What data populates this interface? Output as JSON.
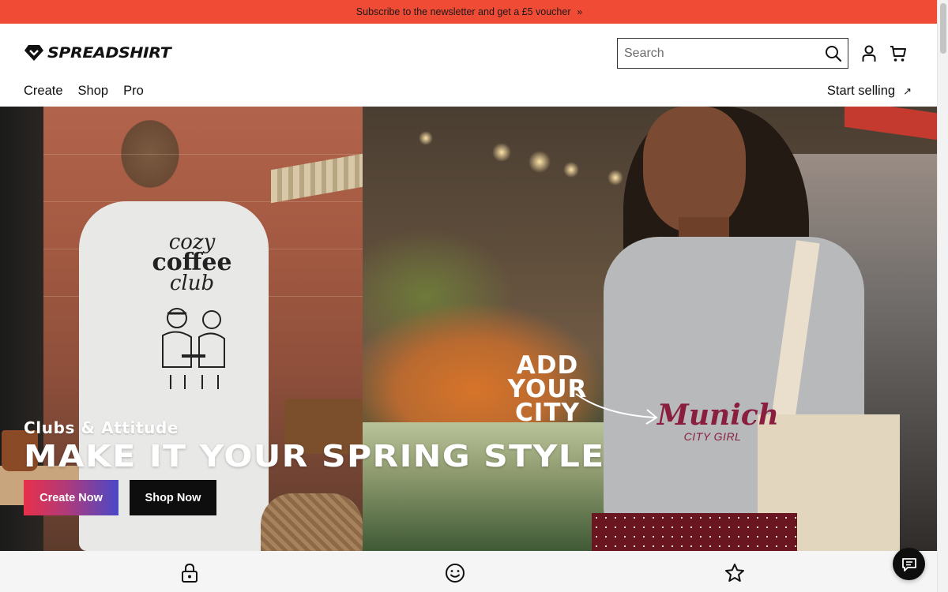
{
  "promo": {
    "text": "Subscribe to the newsletter and get a £5 voucher",
    "chevron": "»"
  },
  "header": {
    "logo_text": "SPREADSHIRT",
    "search": {
      "placeholder": "Search",
      "value": ""
    },
    "icons": [
      "search-icon",
      "account-icon",
      "cart-icon"
    ]
  },
  "nav": {
    "items": [
      {
        "label": "Create"
      },
      {
        "label": "Shop"
      },
      {
        "label": "Pro"
      }
    ],
    "start_selling": {
      "label": "Start selling",
      "arrow": "↗"
    }
  },
  "hero": {
    "eyebrow": "Clubs & Attitude",
    "headline": "MAKE IT YOUR SPRING STYLE",
    "tshirt_print": {
      "line1": "cozy",
      "line2": "coffee",
      "line3": "club"
    },
    "overlay_line1": "ADD YOUR",
    "overlay_line2": "CITY",
    "city_print": {
      "name": "Munich",
      "sub": "CITY GIRL"
    },
    "buttons": {
      "create": "Create Now",
      "shop": "Shop Now"
    }
  },
  "usp_icons": [
    "lock-icon",
    "smiley-icon",
    "star-icon"
  ],
  "chat": {
    "icon": "chat-icon"
  },
  "colors": {
    "promo_bg": "#f04b35",
    "primary_dark": "#0e0e0e",
    "create_gradient_start": "#e8304a",
    "create_gradient_end": "#4a48c8",
    "city_print": "#8a1e3f"
  }
}
